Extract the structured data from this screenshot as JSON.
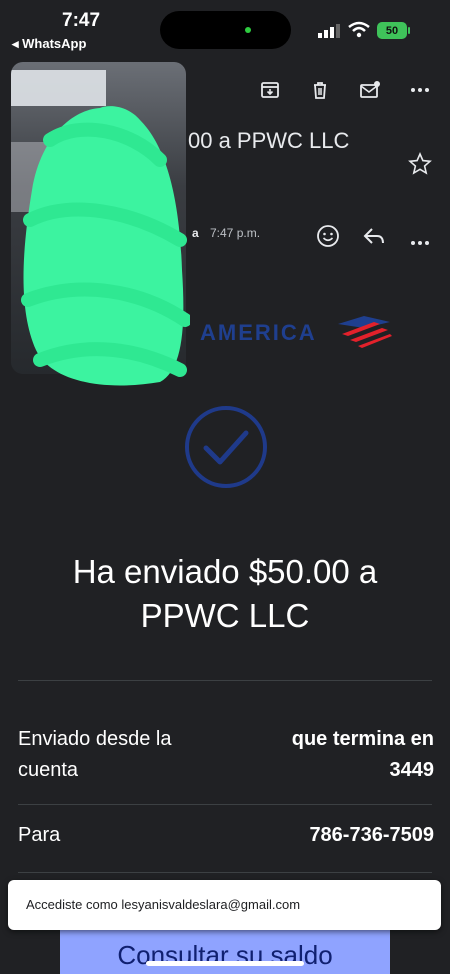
{
  "status_bar": {
    "time": "7:47",
    "back_app": "◂ WhatsApp",
    "battery": "50"
  },
  "toolbar": {
    "icons": [
      "archive-icon",
      "trash-icon",
      "mark-unread-icon",
      "more-icon"
    ]
  },
  "email": {
    "subject_fragment": "00 a PPWC LLC",
    "sender_fragment": "a",
    "time": "7:47 p.m."
  },
  "brand": {
    "text_fragment": "AMERICA",
    "flag_color": "#e3212b",
    "text_color": "#1f3f8f"
  },
  "confirmation": {
    "headline": "Ha enviado $50.00 a PPWC LLC"
  },
  "details": {
    "from_label": "Enviado desde la cuenta",
    "from_value": "que termina en 3449",
    "to_label": "Para",
    "to_value": "786-736-7509"
  },
  "toast": {
    "text": "Accediste como lesyanisvaldeslara@gmail.com"
  },
  "cta": {
    "label": "Consultar su saldo"
  },
  "colors": {
    "background": "#202124",
    "redaction": "#3cf3a0",
    "cta_bg": "#8fa3ff"
  }
}
